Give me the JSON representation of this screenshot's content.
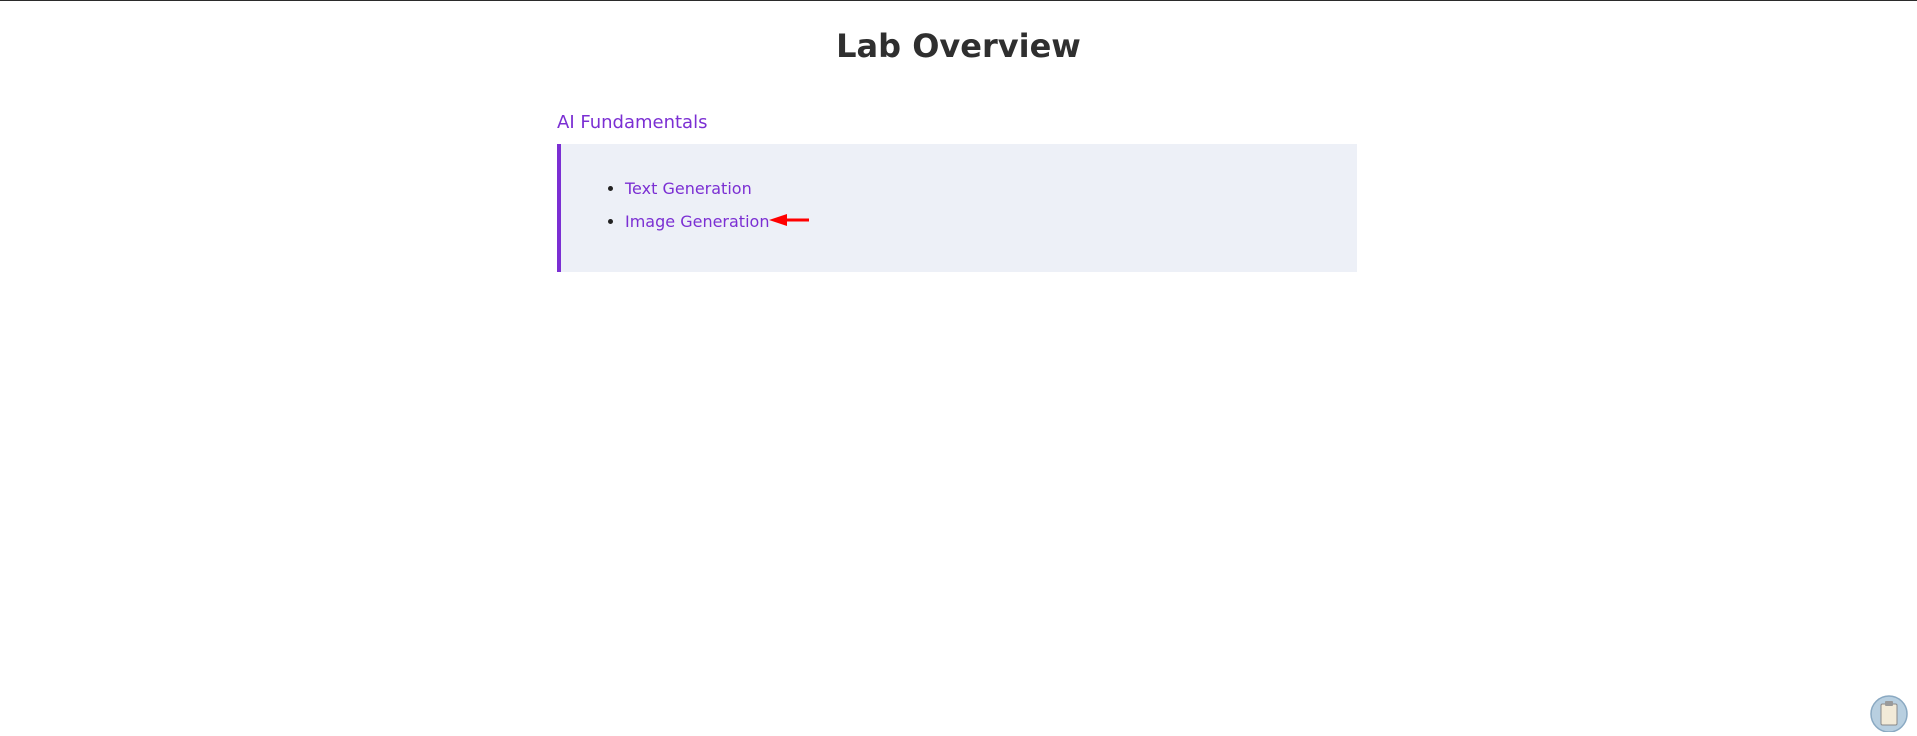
{
  "page": {
    "title": "Lab Overview"
  },
  "section": {
    "title": "AI Fundamentals",
    "items": [
      {
        "label": "Text Generation"
      },
      {
        "label": "Image Generation"
      }
    ]
  },
  "annotation": {
    "arrow_color": "#ff0000",
    "arrow_icon": "left-arrow-icon"
  },
  "floating_button": {
    "icon": "clipboard-icon"
  },
  "colors": {
    "accent": "#7b2fd3",
    "card_bg": "#edf0f7",
    "title": "#2f2f2f"
  }
}
